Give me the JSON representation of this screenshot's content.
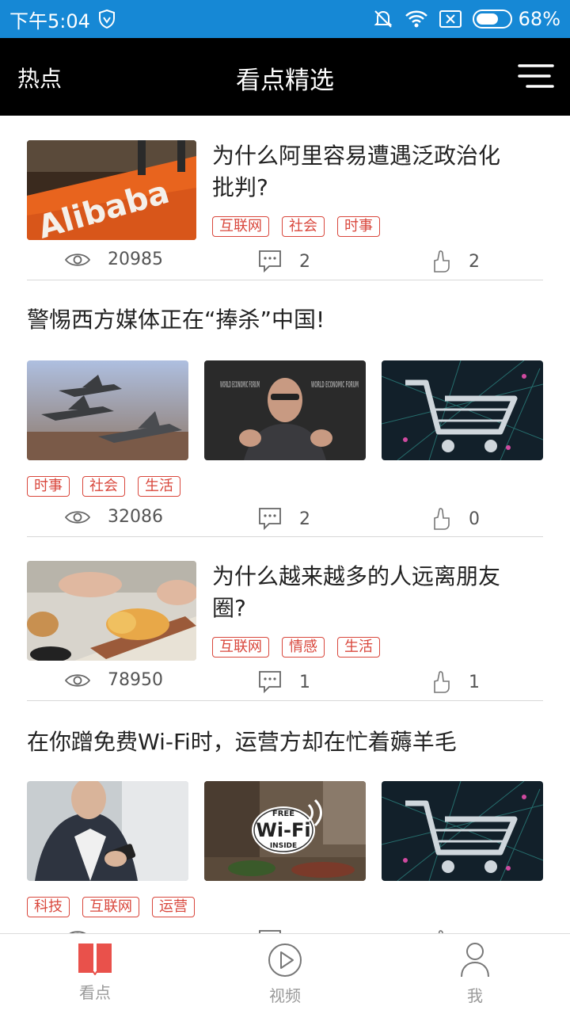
{
  "status_bar": {
    "time": "下午5:04",
    "battery_percent": "68%",
    "battery_level": 0.68
  },
  "header": {
    "left_label": "热点",
    "title": "看点精选",
    "menu_icon": "menu-icon"
  },
  "articles": [
    {
      "title_line1": "为什么阿里容易遭遇泛政治化",
      "title_line2": "批判?",
      "tags": [
        "互联网",
        "社会",
        "时事"
      ],
      "views": "20985",
      "comments": "2",
      "likes": "2"
    },
    {
      "title": "警惕西方媒体正在“捧杀”中国!",
      "tags": [
        "时事",
        "社会",
        "生活"
      ],
      "views": "32086",
      "comments": "2",
      "likes": "0"
    },
    {
      "title_line1": "为什么越来越多的人远离朋友",
      "title_line2": "圈?",
      "tags": [
        "互联网",
        "情感",
        "生活"
      ],
      "views": "78950",
      "comments": "1",
      "likes": "1"
    },
    {
      "title": "在你蹭免费Wi-Fi时，运营方却在忙着薅羊毛",
      "tags": [
        "科技",
        "互联网",
        "运营"
      ],
      "wifi_sign_top": "FREE",
      "wifi_sign_main": "Wi-Fi",
      "wifi_sign_bottom": "INSIDE"
    }
  ],
  "forum_text": {
    "left": "WORLD ECONOMIC FORUM",
    "right": "WORLD ECONOMIC FORUM"
  },
  "alibaba_text": "Alibaba",
  "bottom_nav": [
    {
      "label": "看点",
      "icon": "book-icon"
    },
    {
      "label": "视频",
      "icon": "play-icon"
    },
    {
      "label": "我",
      "icon": "person-icon"
    }
  ],
  "colors": {
    "status_bar": "#1688d5",
    "header": "#000000",
    "tag": "#d9473c",
    "active_nav_icon": "#e9514b"
  }
}
